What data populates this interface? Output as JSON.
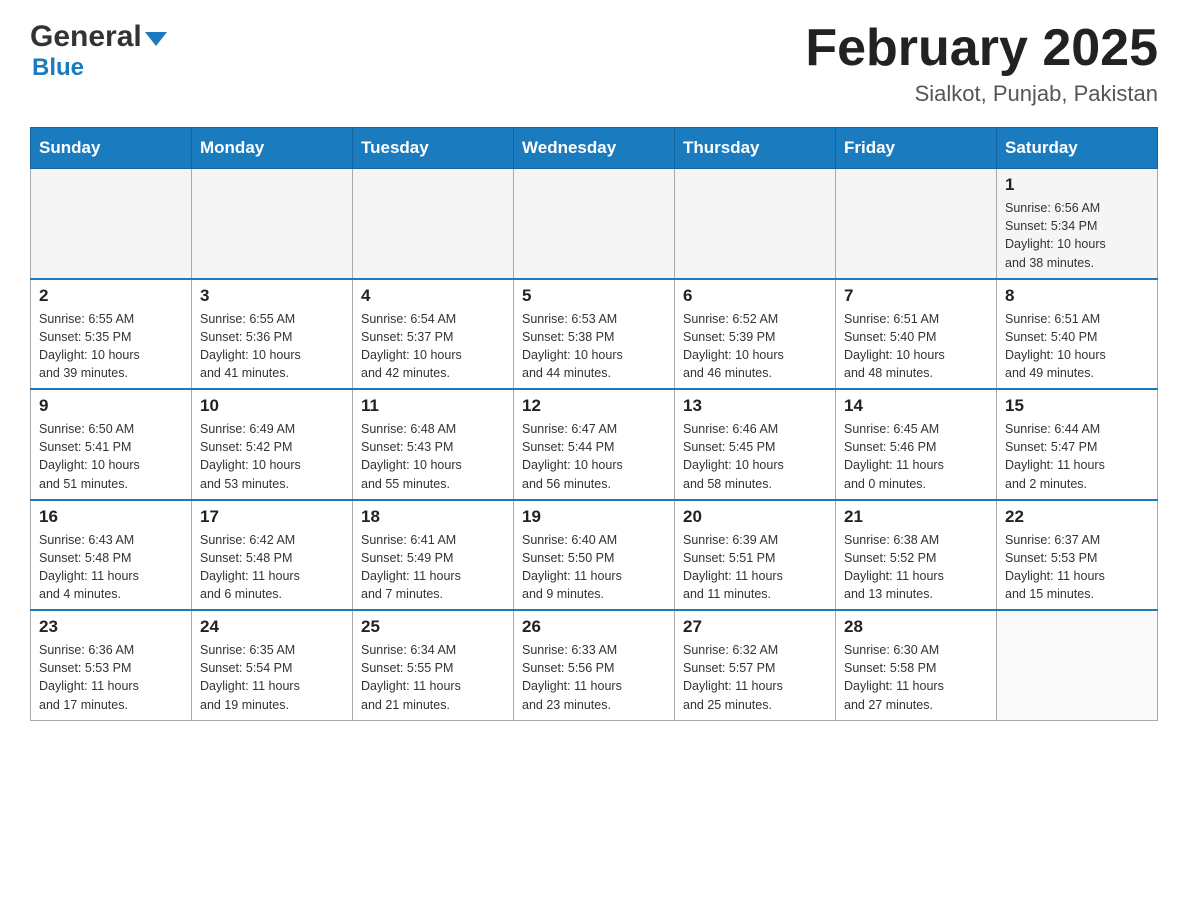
{
  "header": {
    "logo_general": "General",
    "logo_blue": "Blue",
    "title": "February 2025",
    "subtitle": "Sialkot, Punjab, Pakistan"
  },
  "days_of_week": [
    "Sunday",
    "Monday",
    "Tuesday",
    "Wednesday",
    "Thursday",
    "Friday",
    "Saturday"
  ],
  "weeks": [
    [
      {
        "day": "",
        "info": ""
      },
      {
        "day": "",
        "info": ""
      },
      {
        "day": "",
        "info": ""
      },
      {
        "day": "",
        "info": ""
      },
      {
        "day": "",
        "info": ""
      },
      {
        "day": "",
        "info": ""
      },
      {
        "day": "1",
        "info": "Sunrise: 6:56 AM\nSunset: 5:34 PM\nDaylight: 10 hours\nand 38 minutes."
      }
    ],
    [
      {
        "day": "2",
        "info": "Sunrise: 6:55 AM\nSunset: 5:35 PM\nDaylight: 10 hours\nand 39 minutes."
      },
      {
        "day": "3",
        "info": "Sunrise: 6:55 AM\nSunset: 5:36 PM\nDaylight: 10 hours\nand 41 minutes."
      },
      {
        "day": "4",
        "info": "Sunrise: 6:54 AM\nSunset: 5:37 PM\nDaylight: 10 hours\nand 42 minutes."
      },
      {
        "day": "5",
        "info": "Sunrise: 6:53 AM\nSunset: 5:38 PM\nDaylight: 10 hours\nand 44 minutes."
      },
      {
        "day": "6",
        "info": "Sunrise: 6:52 AM\nSunset: 5:39 PM\nDaylight: 10 hours\nand 46 minutes."
      },
      {
        "day": "7",
        "info": "Sunrise: 6:51 AM\nSunset: 5:40 PM\nDaylight: 10 hours\nand 48 minutes."
      },
      {
        "day": "8",
        "info": "Sunrise: 6:51 AM\nSunset: 5:40 PM\nDaylight: 10 hours\nand 49 minutes."
      }
    ],
    [
      {
        "day": "9",
        "info": "Sunrise: 6:50 AM\nSunset: 5:41 PM\nDaylight: 10 hours\nand 51 minutes."
      },
      {
        "day": "10",
        "info": "Sunrise: 6:49 AM\nSunset: 5:42 PM\nDaylight: 10 hours\nand 53 minutes."
      },
      {
        "day": "11",
        "info": "Sunrise: 6:48 AM\nSunset: 5:43 PM\nDaylight: 10 hours\nand 55 minutes."
      },
      {
        "day": "12",
        "info": "Sunrise: 6:47 AM\nSunset: 5:44 PM\nDaylight: 10 hours\nand 56 minutes."
      },
      {
        "day": "13",
        "info": "Sunrise: 6:46 AM\nSunset: 5:45 PM\nDaylight: 10 hours\nand 58 minutes."
      },
      {
        "day": "14",
        "info": "Sunrise: 6:45 AM\nSunset: 5:46 PM\nDaylight: 11 hours\nand 0 minutes."
      },
      {
        "day": "15",
        "info": "Sunrise: 6:44 AM\nSunset: 5:47 PM\nDaylight: 11 hours\nand 2 minutes."
      }
    ],
    [
      {
        "day": "16",
        "info": "Sunrise: 6:43 AM\nSunset: 5:48 PM\nDaylight: 11 hours\nand 4 minutes."
      },
      {
        "day": "17",
        "info": "Sunrise: 6:42 AM\nSunset: 5:48 PM\nDaylight: 11 hours\nand 6 minutes."
      },
      {
        "day": "18",
        "info": "Sunrise: 6:41 AM\nSunset: 5:49 PM\nDaylight: 11 hours\nand 7 minutes."
      },
      {
        "day": "19",
        "info": "Sunrise: 6:40 AM\nSunset: 5:50 PM\nDaylight: 11 hours\nand 9 minutes."
      },
      {
        "day": "20",
        "info": "Sunrise: 6:39 AM\nSunset: 5:51 PM\nDaylight: 11 hours\nand 11 minutes."
      },
      {
        "day": "21",
        "info": "Sunrise: 6:38 AM\nSunset: 5:52 PM\nDaylight: 11 hours\nand 13 minutes."
      },
      {
        "day": "22",
        "info": "Sunrise: 6:37 AM\nSunset: 5:53 PM\nDaylight: 11 hours\nand 15 minutes."
      }
    ],
    [
      {
        "day": "23",
        "info": "Sunrise: 6:36 AM\nSunset: 5:53 PM\nDaylight: 11 hours\nand 17 minutes."
      },
      {
        "day": "24",
        "info": "Sunrise: 6:35 AM\nSunset: 5:54 PM\nDaylight: 11 hours\nand 19 minutes."
      },
      {
        "day": "25",
        "info": "Sunrise: 6:34 AM\nSunset: 5:55 PM\nDaylight: 11 hours\nand 21 minutes."
      },
      {
        "day": "26",
        "info": "Sunrise: 6:33 AM\nSunset: 5:56 PM\nDaylight: 11 hours\nand 23 minutes."
      },
      {
        "day": "27",
        "info": "Sunrise: 6:32 AM\nSunset: 5:57 PM\nDaylight: 11 hours\nand 25 minutes."
      },
      {
        "day": "28",
        "info": "Sunrise: 6:30 AM\nSunset: 5:58 PM\nDaylight: 11 hours\nand 27 minutes."
      },
      {
        "day": "",
        "info": ""
      }
    ]
  ]
}
